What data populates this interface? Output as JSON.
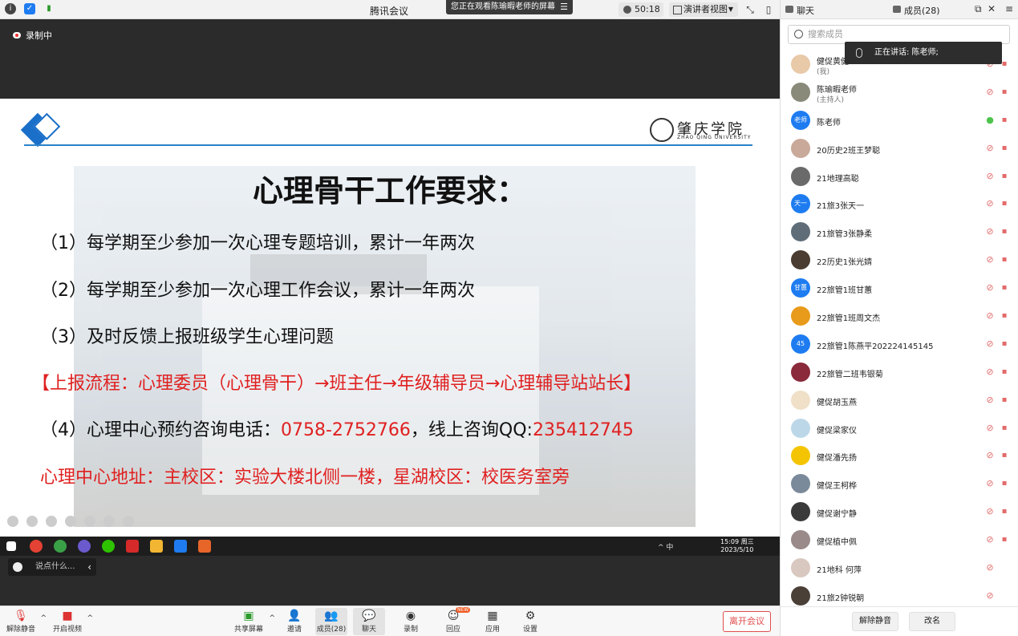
{
  "topbar": {
    "app_title": "腾讯会议",
    "share_banner": "您正在观看陈瑜暇老师的屏幕",
    "timer": "50:18",
    "view_mode": "演讲者视图"
  },
  "stage": {
    "recording_label": "录制中",
    "chat_placeholder": "说点什么..."
  },
  "slide": {
    "title": "心理骨干工作要求：",
    "university_name": "肇庆学院",
    "university_en": "ZHAO QING UNIVERSITY",
    "line1": "（1）每学期至少参加一次心理专题培训，累计一年两次",
    "line2": "（2）每学期至少参加一次心理工作会议，累计一年两次",
    "line3": "（3）及时反馈上报班级学生心理问题",
    "line4": "【上报流程：心理委员（心理骨干）→班主任→年级辅导员→心理辅导站站长】",
    "line5_prefix": "（4）心理中心预约咨询电话：",
    "line5_phone": "0758-2752766",
    "line5_mid": "，线上咨询QQ:",
    "line5_qq": "235412745",
    "line6": "心理中心地址：主校区：实验大楼北侧一楼，星湖校区：校医务室旁"
  },
  "winbar": {
    "time": "15:09 周三",
    "date": "2023/5/10",
    "tray": "^ 中"
  },
  "toolbar": {
    "unmute": "解除静音",
    "video": "开启视频",
    "share": "共享屏幕",
    "invite": "邀请",
    "members": "成员(28)",
    "chat": "聊天",
    "record": "录制",
    "review": "回应",
    "review_badge": "NEW",
    "apps": "应用",
    "settings": "设置",
    "leave": "离开会议"
  },
  "panel": {
    "tab_chat": "聊天",
    "tab_members": "成员(28)",
    "search_placeholder": "搜索成员",
    "speaking": "正在讲话: 陈老师;",
    "members": [
      {
        "name": "健促黄健",
        "role": "(我)",
        "avatar_color": "#e8c9a8"
      },
      {
        "name": "陈瑜暇老师",
        "role": "(主持人)",
        "avatar_color": "#8a8a7a"
      },
      {
        "name": "陈老师",
        "role": "",
        "avatar_text": "老师",
        "avatar_color": "#1e7cf0"
      },
      {
        "name": "20历史2班王梦聪",
        "role": "",
        "avatar_color": "#c9a99a"
      },
      {
        "name": "21地理高聪",
        "role": "",
        "avatar_color": "#6a6a6a"
      },
      {
        "name": "21旅3张天一",
        "role": "",
        "avatar_text": "天一",
        "avatar_color": "#1e7cf0"
      },
      {
        "name": "21旅管3张静柔",
        "role": "",
        "avatar_color": "#5f6d78"
      },
      {
        "name": "22历史1张光婧",
        "role": "",
        "avatar_color": "#4a3c30"
      },
      {
        "name": "22旅管1班甘蕙",
        "role": "",
        "avatar_text": "甘蕙",
        "avatar_color": "#1e7cf0"
      },
      {
        "name": "22旅管1班周文杰",
        "role": "",
        "avatar_color": "#e89a1a"
      },
      {
        "name": "22旅管1陈燕平202224145145",
        "role": "",
        "avatar_text": "45",
        "avatar_color": "#1e7cf0"
      },
      {
        "name": "22旅管二班韦银菊",
        "role": "",
        "avatar_color": "#8a2a3a"
      },
      {
        "name": "健促胡玉燕",
        "role": "",
        "avatar_color": "#f0e0c8"
      },
      {
        "name": "健促梁家仪",
        "role": "",
        "avatar_color": "#bcd8e8"
      },
      {
        "name": "健促潘先扬",
        "role": "",
        "avatar_color": "#f5c400"
      },
      {
        "name": "健促王柯桦",
        "role": "",
        "avatar_color": "#7a8a9a"
      },
      {
        "name": "健促谢宁静",
        "role": "",
        "avatar_color": "#3a3a3a"
      },
      {
        "name": "健促植中佩",
        "role": "",
        "avatar_color": "#9a8a8a"
      },
      {
        "name": "21地科 何萍",
        "role": "",
        "avatar_color": "#d8c8c0"
      },
      {
        "name": "21旅2钟锐朝",
        "role": "",
        "avatar_color": "#4a4038"
      }
    ],
    "btn_unmute": "解除静音",
    "btn_rename": "改名"
  }
}
